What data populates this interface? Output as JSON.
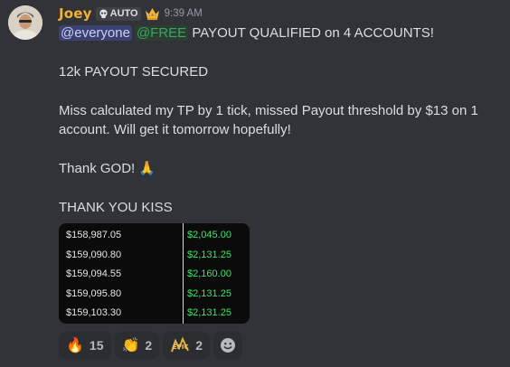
{
  "message": {
    "author": {
      "username": "Joey",
      "badge_label": "AUTO",
      "badge_icon": "skull-icon",
      "role_icon": "crown-icon"
    },
    "timestamp": "9:39 AM",
    "lines": {
      "mention_everyone": "@everyone",
      "mention_role": "@FREE",
      "headline": " PAYOUT QUALIFIED on 4 ACCOUNTS!",
      "secured": "12k PAYOUT SECURED",
      "explanation": "Miss calculated my TP by 1 tick, missed Payout threshold by $13 on 1 account. Will get it tomorrow hopefully!",
      "thanks": "Thank GOD!",
      "thanks_emoji": "🙏",
      "kiss": "THANK YOU KISS"
    },
    "attachment": {
      "rows": [
        {
          "balance": "$158,987.05",
          "payout": "$2,045.00"
        },
        {
          "balance": "$159,090.80",
          "payout": "$2,131.25"
        },
        {
          "balance": "$159,094.55",
          "payout": "$2,160.00"
        },
        {
          "balance": "$159,095.80",
          "payout": "$2,131.25"
        },
        {
          "balance": "$159,103.30",
          "payout": "$2,131.25"
        }
      ]
    },
    "reactions": [
      {
        "icon": "fire-icon",
        "emoji": "🔥",
        "count": "15"
      },
      {
        "icon": "clapping-hands-icon",
        "emoji": "👏",
        "count": "2"
      },
      {
        "icon": "epic-sticker-icon",
        "emoji": "EPIC",
        "count": "2"
      }
    ],
    "colors": {
      "username": "#f0b232",
      "mention_bg": "#3c4270",
      "role_mention": "#3ba55d",
      "payout_green": "#3fe36a",
      "background": "#313338"
    }
  }
}
